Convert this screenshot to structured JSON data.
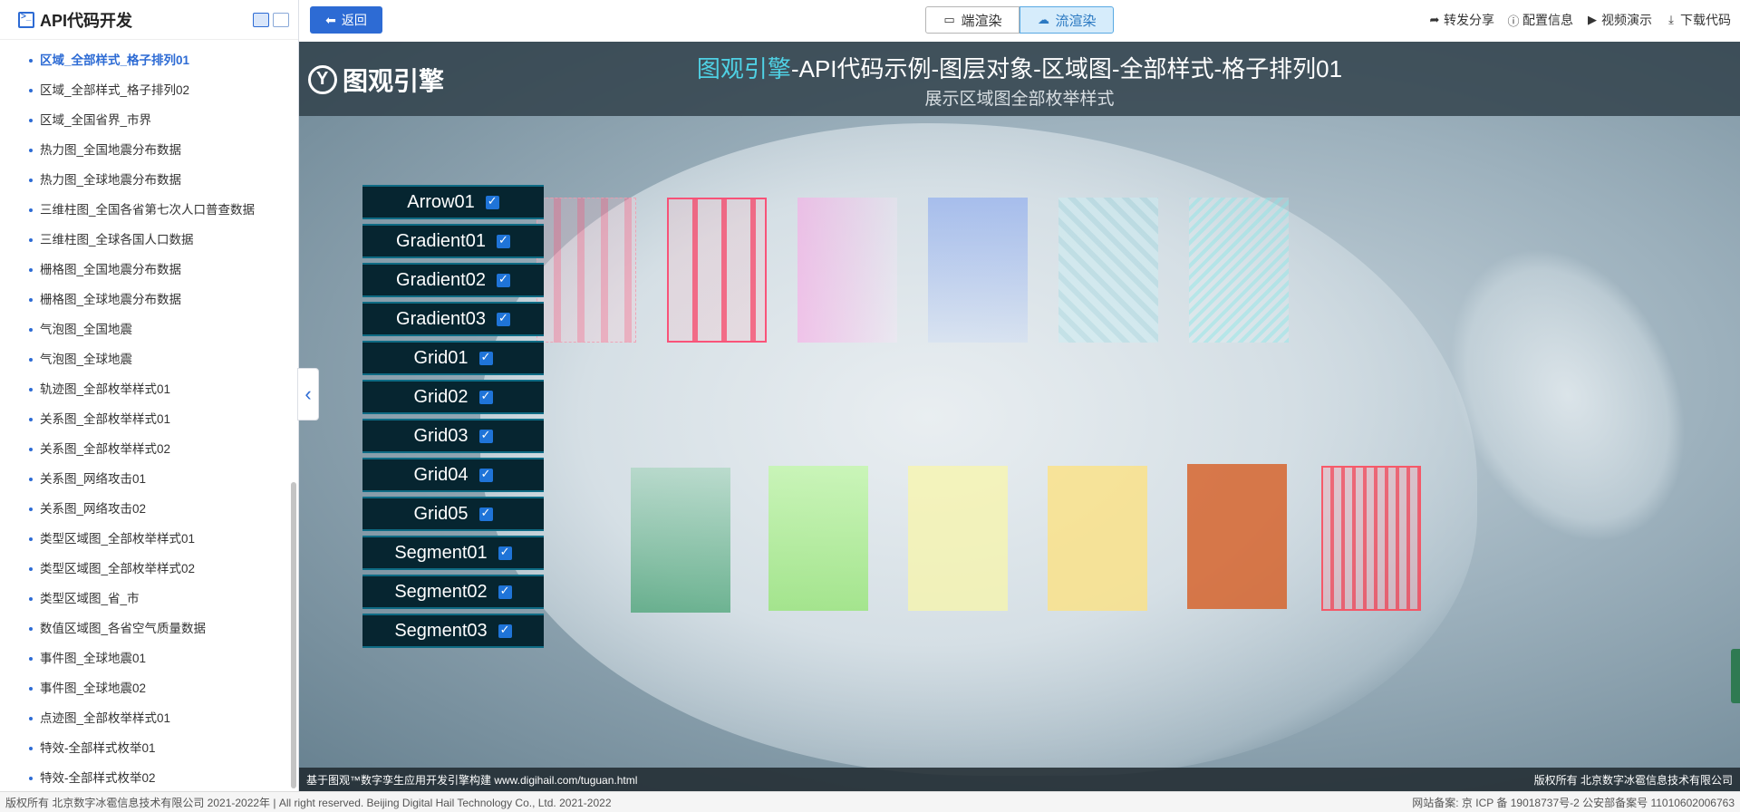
{
  "sidebar": {
    "title": "API代码开发",
    "items": [
      {
        "label": "区域_全部样式_格子排列01",
        "active": true
      },
      {
        "label": "区域_全部样式_格子排列02"
      },
      {
        "label": "区域_全国省界_市界"
      },
      {
        "label": "热力图_全国地震分布数据"
      },
      {
        "label": "热力图_全球地震分布数据"
      },
      {
        "label": "三维柱图_全国各省第七次人口普查数据"
      },
      {
        "label": "三维柱图_全球各国人口数据"
      },
      {
        "label": "栅格图_全国地震分布数据"
      },
      {
        "label": "栅格图_全球地震分布数据"
      },
      {
        "label": "气泡图_全国地震"
      },
      {
        "label": "气泡图_全球地震"
      },
      {
        "label": "轨迹图_全部枚举样式01"
      },
      {
        "label": "关系图_全部枚举样式01"
      },
      {
        "label": "关系图_全部枚举样式02"
      },
      {
        "label": "关系图_网络攻击01"
      },
      {
        "label": "关系图_网络攻击02"
      },
      {
        "label": "类型区域图_全部枚举样式01"
      },
      {
        "label": "类型区域图_全部枚举样式02"
      },
      {
        "label": "类型区域图_省_市"
      },
      {
        "label": "数值区域图_各省空气质量数据"
      },
      {
        "label": "事件图_全球地震01"
      },
      {
        "label": "事件图_全球地震02"
      },
      {
        "label": "点迹图_全部枚举样式01"
      },
      {
        "label": "特效-全部样式枚举01"
      },
      {
        "label": "特效-全部样式枚举02"
      }
    ]
  },
  "topbar": {
    "back_label": "返回",
    "render_options": [
      {
        "label": "端渲染",
        "icon": "monitor-icon",
        "active": false
      },
      {
        "label": "流渲染",
        "icon": "cloud-icon",
        "active": true
      }
    ],
    "actions": [
      {
        "label": "转发分享",
        "icon": "share-icon"
      },
      {
        "label": "配置信息",
        "icon": "info-icon"
      },
      {
        "label": "视频演示",
        "icon": "play-icon"
      },
      {
        "label": "下载代码",
        "icon": "download-icon"
      }
    ]
  },
  "viewport": {
    "brand": "图观引擎",
    "title_highlight": "图观引擎",
    "title_rest": "-API代码示例-图层对象-区域图-全部样式-格子排列01",
    "subtitle": "展示区域图全部枚举样式",
    "layers": [
      {
        "label": "Arrow01",
        "checked": true
      },
      {
        "label": "Gradient01",
        "checked": true
      },
      {
        "label": "Gradient02",
        "checked": true
      },
      {
        "label": "Gradient03",
        "checked": true
      },
      {
        "label": "Grid01",
        "checked": true
      },
      {
        "label": "Grid02",
        "checked": true
      },
      {
        "label": "Grid03",
        "checked": true
      },
      {
        "label": "Grid04",
        "checked": true
      },
      {
        "label": "Grid05",
        "checked": true
      },
      {
        "label": "Segment01",
        "checked": true
      },
      {
        "label": "Segment02",
        "checked": true
      },
      {
        "label": "Segment03",
        "checked": true
      }
    ],
    "footer_left": "基于图观™数字孪生应用开发引擎构建 www.digihail.com/tuguan.html",
    "footer_right": "版权所有 北京数字冰雹信息技术有限公司"
  },
  "bottombar": {
    "left": "版权所有 北京数字冰雹信息技术有限公司 2021-2022年 | All right reserved. Beijing Digital Hail Technology Co., Ltd. 2021-2022",
    "right": "网站备案: 京 ICP 备 19018737号-2 公安部备案号 11010602006763"
  },
  "colors": {
    "accent": "#2d6bd4",
    "title_highlight": "#4fd1e4",
    "panel_bg": "#062530"
  }
}
